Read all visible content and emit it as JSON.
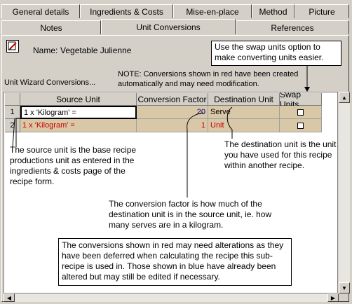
{
  "tabs_row1": [
    "General details",
    "Ingredients & Costs",
    "Mise-en-place",
    "Method",
    "Picture"
  ],
  "tabs_row2": [
    "Notes",
    "Unit Conversions",
    "References"
  ],
  "active_tab": "Unit Conversions",
  "name_label": "Name:",
  "name_value": "Vegetable Julienne",
  "wizard_label": "Unit Wizard Conversions...",
  "note_text": "NOTE: Conversions shown in red have been created automatically and may need modification.",
  "swap_tip": "Use the swap units option to make converting units easier.",
  "grid": {
    "headers": [
      "Source Unit",
      "Conversion Factor",
      "Destination Unit",
      "Swap Units"
    ],
    "rows": [
      {
        "num": "1",
        "source": "1 x 'Kilogram' =",
        "factor": "20",
        "dest": "Serve",
        "source_color": "#000000",
        "factor_color": "#000080",
        "dest_color": "#000000"
      },
      {
        "num": "2",
        "source": "1 x 'Kilogram' =",
        "factor": "1",
        "dest": "Unit",
        "source_color": "#cc0000",
        "factor_color": "#cc0000",
        "dest_color": "#cc0000"
      }
    ]
  },
  "callouts": {
    "source": "The source unit is the base recipe productions unit as entered in the ingredients & costs page of the recipe form.",
    "dest": "The destination unit is the unit you have used for this recipe within another recipe.",
    "factor": "The conversion factor is how much of the destination unit is in the source unit, ie. how many serves are in a kilogram.",
    "red": "The conversions shown in red may need alterations as they have been deferred when calculating the recipe this sub-recipe is used in.  Those shown in blue have already been altered but may still be edited if necessary."
  },
  "icons": {
    "edit": "edit-pencil-icon"
  }
}
